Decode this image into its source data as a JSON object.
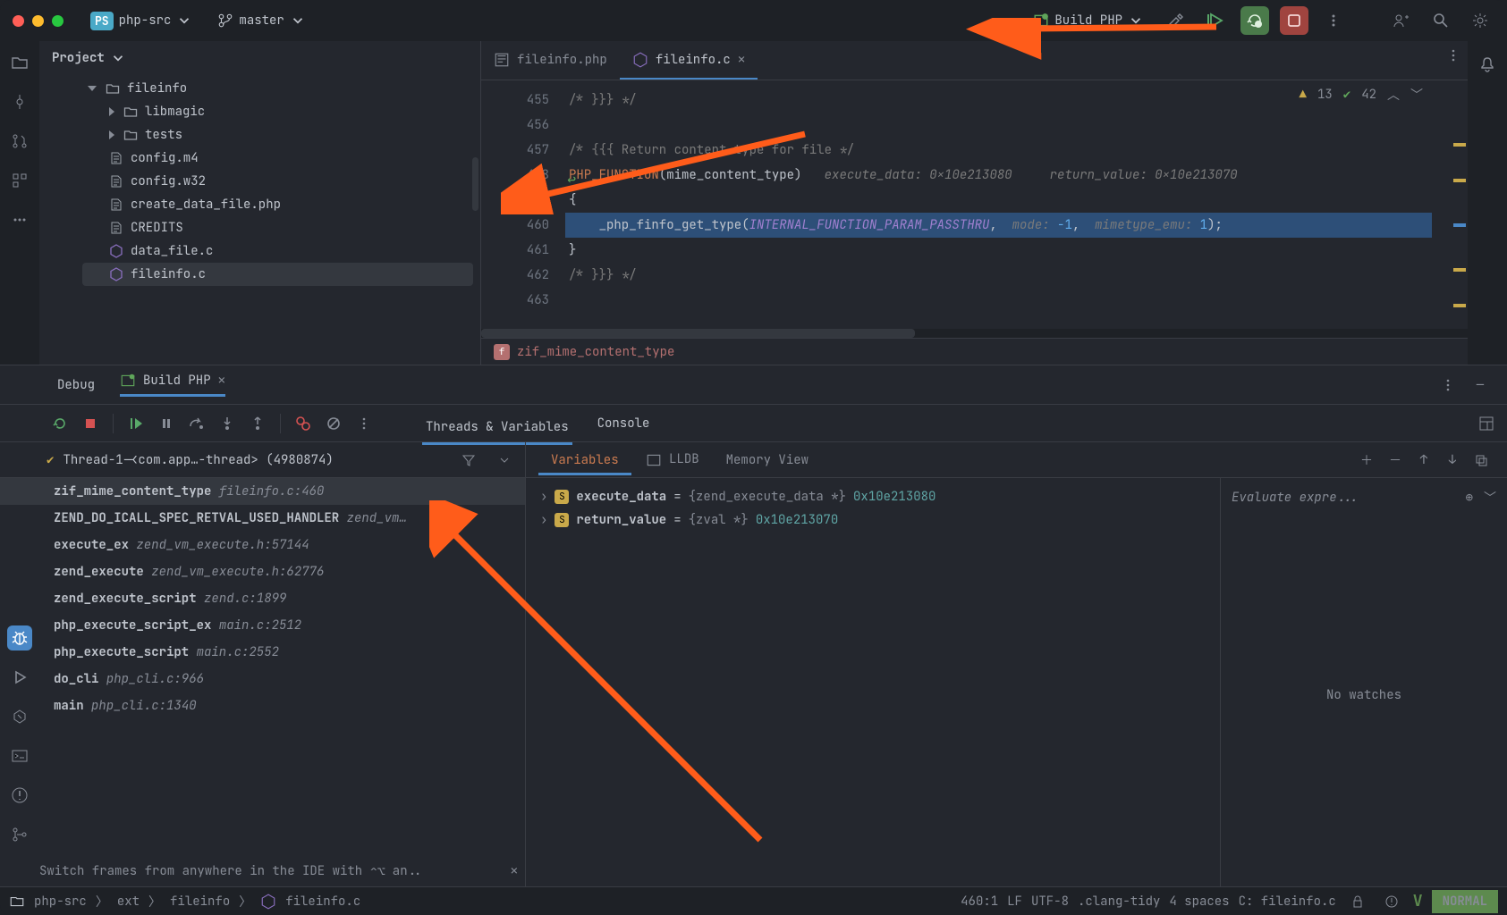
{
  "header": {
    "project": "php-src",
    "branch": "master",
    "run_config": "Build PHP"
  },
  "sidebar": {
    "title": "Project",
    "tree": [
      {
        "depth": 0,
        "kind": "folder",
        "open": true,
        "label": "fileinfo"
      },
      {
        "depth": 1,
        "kind": "folder",
        "open": false,
        "label": "libmagic"
      },
      {
        "depth": 1,
        "kind": "folder",
        "open": false,
        "label": "tests"
      },
      {
        "depth": 1,
        "kind": "file",
        "label": "config.m4"
      },
      {
        "depth": 1,
        "kind": "file",
        "label": "config.w32"
      },
      {
        "depth": 1,
        "kind": "file",
        "label": "create_data_file.php"
      },
      {
        "depth": 1,
        "kind": "file",
        "label": "CREDITS"
      },
      {
        "depth": 1,
        "kind": "cfile",
        "label": "data_file.c"
      },
      {
        "depth": 1,
        "kind": "cfile",
        "label": "fileinfo.c",
        "selected": true
      }
    ]
  },
  "editor": {
    "tabs": [
      {
        "label": "fileinfo.php",
        "active": false,
        "closable": false
      },
      {
        "label": "fileinfo.c",
        "active": true,
        "closable": true
      }
    ],
    "inspections": {
      "warnings": 13,
      "ok": 42
    },
    "lines": [
      {
        "n": 455,
        "segs": [
          {
            "c": "c-com",
            "t": "/* }}} */"
          }
        ]
      },
      {
        "n": 456,
        "segs": []
      },
      {
        "n": 457,
        "segs": [
          {
            "c": "c-com",
            "t": "/* {{{ Return content-type for file */"
          }
        ]
      },
      {
        "n": 458,
        "ret": true,
        "segs": [
          {
            "c": "c-kw",
            "t": "PHP_FUNCTION"
          },
          {
            "t": "("
          },
          {
            "c": "",
            "t": "mime_content_type"
          },
          {
            "t": ")   "
          },
          {
            "c": "c-hint",
            "t": "execute_data: 0x10e213080     return_value: 0x10e213070"
          }
        ]
      },
      {
        "n": 459,
        "segs": [
          {
            "t": "{"
          }
        ]
      },
      {
        "n": 460,
        "bp": true,
        "exec": true,
        "hl": true,
        "step": true,
        "segs": [
          {
            "t": "    _php_finfo_get_type("
          },
          {
            "c": "c-const",
            "t": "INTERNAL_FUNCTION_PARAM_PASSTHRU"
          },
          {
            "t": ", "
          },
          {
            "c": "c-hint",
            "t": " mode: "
          },
          {
            "c": "c-num",
            "t": "-1"
          },
          {
            "t": ","
          },
          {
            "c": "c-hint",
            "t": "  mimetype_emu: "
          },
          {
            "c": "c-num",
            "t": "1"
          },
          {
            "t": ");"
          }
        ]
      },
      {
        "n": 461,
        "segs": [
          {
            "t": "}"
          }
        ]
      },
      {
        "n": 462,
        "segs": [
          {
            "c": "c-com",
            "t": "/* }}} */"
          }
        ]
      },
      {
        "n": 463,
        "segs": []
      }
    ],
    "breadcrumb_fn": "zif_mime_content_type"
  },
  "debug": {
    "tabs": {
      "tool": "Debug",
      "config": "Build PHP"
    },
    "view_tabs": [
      "Threads & Variables",
      "Console"
    ],
    "thread": "Thread-1-<com.app…-thread> (4980874)",
    "frames": [
      {
        "fn": "zif_mime_content_type",
        "loc": "fileinfo.c:460",
        "selected": true
      },
      {
        "fn": "ZEND_DO_ICALL_SPEC_RETVAL_USED_HANDLER",
        "loc": "zend_vm…"
      },
      {
        "fn": "execute_ex",
        "loc": "zend_vm_execute.h:57144"
      },
      {
        "fn": "zend_execute",
        "loc": "zend_vm_execute.h:62776"
      },
      {
        "fn": "zend_execute_script",
        "loc": "zend.c:1899"
      },
      {
        "fn": "php_execute_script_ex",
        "loc": "main.c:2512"
      },
      {
        "fn": "php_execute_script",
        "loc": "main.c:2552"
      },
      {
        "fn": "do_cli",
        "loc": "php_cli.c:966"
      },
      {
        "fn": "main",
        "loc": "php_cli.c:1340"
      }
    ],
    "frames_hint": "Switch frames from anywhere in the IDE with ⌃⌥ an..",
    "var_tabs": [
      "Variables",
      "LLDB",
      "Memory View"
    ],
    "variables": [
      {
        "name": "execute_data",
        "type": "{zend_execute_data *}",
        "value": "0x10e213080"
      },
      {
        "name": "return_value",
        "type": "{zval *}",
        "value": "0x10e213070"
      }
    ],
    "watches": {
      "placeholder": "Evaluate expre...",
      "empty": "No watches"
    }
  },
  "status": {
    "crumbs": [
      "php-src",
      "ext",
      "fileinfo",
      "fileinfo.c"
    ],
    "pos": "460:1",
    "eol": "LF",
    "enc": "UTF-8",
    "lang": ".clang-tidy",
    "indent": "4 spaces",
    "context": "C: fileinfo.c",
    "vim": "NORMAL"
  }
}
